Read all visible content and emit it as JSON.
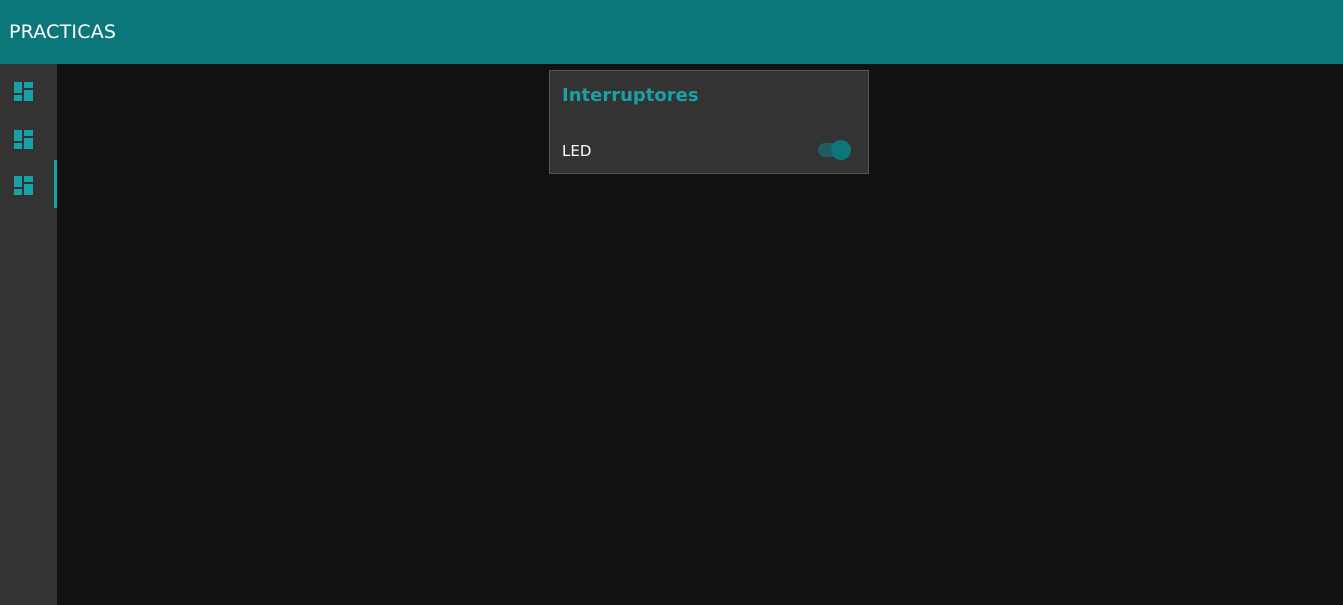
{
  "header": {
    "title": "PRACTICAS"
  },
  "sidebar": {
    "items": [
      {
        "icon": "dashboard-icon",
        "active": false
      },
      {
        "icon": "dashboard-icon",
        "active": false
      },
      {
        "icon": "dashboard-icon",
        "active": true
      }
    ]
  },
  "main": {
    "card": {
      "title": "Interruptores",
      "switch": {
        "label": "LED",
        "state": "on"
      }
    }
  },
  "colors": {
    "header_bg": "#0b777b",
    "accent": "#17a2a8",
    "sidebar_bg": "#333333",
    "content_bg": "#111111",
    "card_bg": "#333333"
  }
}
